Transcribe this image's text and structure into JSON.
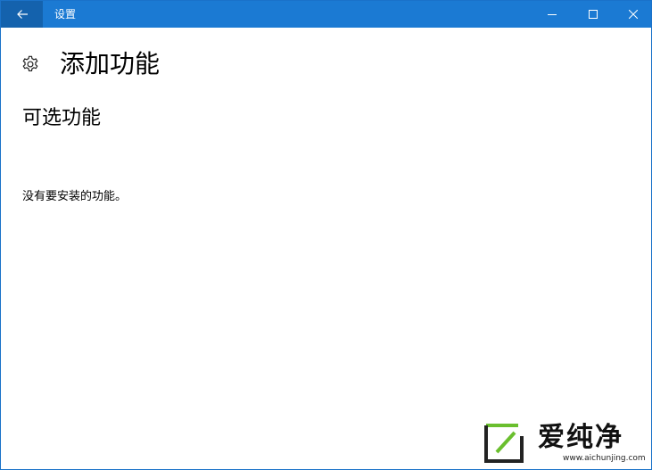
{
  "titlebar": {
    "title": "设置",
    "back_icon": "back-arrow-icon",
    "minimize_icon": "minimize-icon",
    "maximize_icon": "maximize-icon",
    "close_icon": "close-icon",
    "accent_color": "#1b7ad3",
    "back_button_color": "#1462ad"
  },
  "page": {
    "icon": "gear-icon",
    "title": "添加功能",
    "section_title": "可选功能",
    "empty_message": "没有要安装的功能。"
  },
  "watermark": {
    "brand": "爱纯净",
    "url": "www.aichunjing.com",
    "logo_color": "#6abf2e"
  }
}
